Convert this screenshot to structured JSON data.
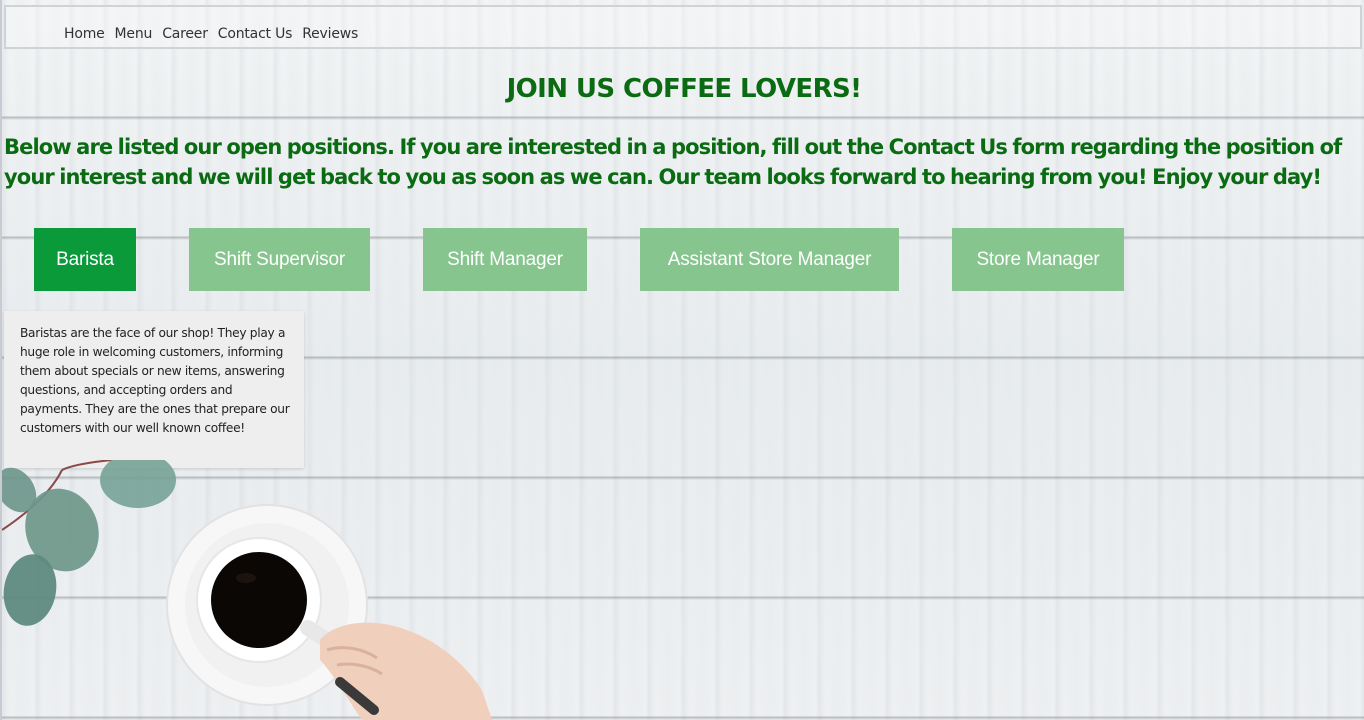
{
  "nav": {
    "items": [
      "Home",
      "Menu",
      "Career",
      "Contact Us",
      "Reviews"
    ]
  },
  "page": {
    "title": "JOIN US COFFEE LOVERS!",
    "intro": "Below are listed our open positions. If you are interested in a position, fill out the Contact Us form regarding the position of your interest and we will get back to you as soon as we can. Our team looks forward to hearing from you! Enjoy your day!"
  },
  "tabs": [
    {
      "label": "Barista",
      "active": true
    },
    {
      "label": "Shift Supervisor",
      "active": false
    },
    {
      "label": "Shift Manager",
      "active": false
    },
    {
      "label": "Assistant Store Manager",
      "active": false
    },
    {
      "label": "Store Manager",
      "active": false
    }
  ],
  "description": {
    "text": "Baristas are the face of our shop! They play a huge role in welcoming customers, informing them about specials or new items, answering questions, and accepting orders and payments. They are the ones that prepare our customers with our well known coffee!"
  },
  "colors": {
    "heading_green": "#0a6b12",
    "tab_active": "#0b9a3a",
    "tab_inactive": "#86c58e",
    "panel_bg": "#efeeee"
  },
  "icons": {
    "background": "coffee-cup-on-wood-image"
  }
}
